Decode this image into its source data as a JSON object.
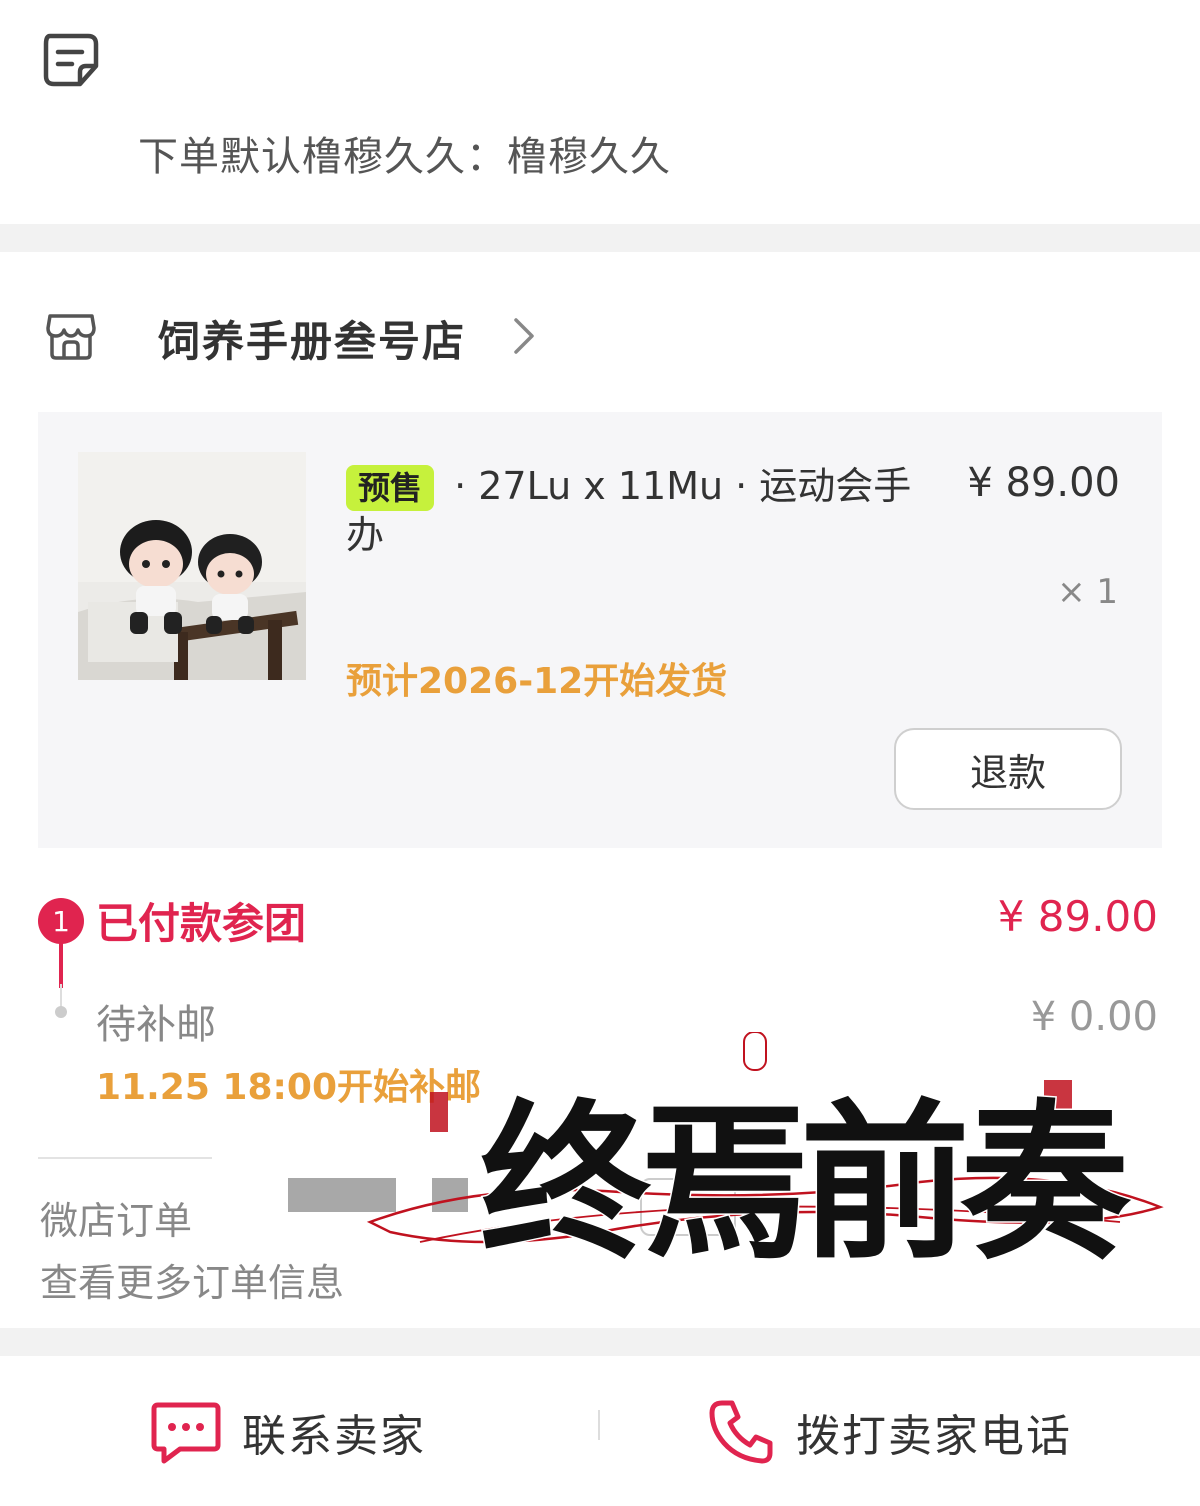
{
  "note": {
    "icon": "note-icon",
    "text": "下单默认橹穆久久：橹穆久久"
  },
  "shop": {
    "icon": "shop-icon",
    "name": "饲养手册叁号店",
    "chevron": "chevron-right-icon"
  },
  "product": {
    "tag": "预售",
    "title": " · 27Lu x 11Mu · 运动会手办",
    "price": "¥ 89.00",
    "quantity": "× 1",
    "ship_note": "预计2026-12开始发货",
    "refund_label": "退款"
  },
  "steps": [
    {
      "number": "1",
      "label": "已付款参团",
      "price": "¥ 89.00"
    },
    {
      "label": "待补邮",
      "price": "¥ 0.00",
      "note": "11.25 18:00开始补邮"
    }
  ],
  "order": {
    "order_label": "微店订单",
    "more_label": "查看更多订单信息"
  },
  "watermark": {
    "text": "终焉前奏"
  },
  "bottom_bar": {
    "contact_label": "联系卖家",
    "call_label": "拨打卖家电话"
  },
  "colors": {
    "accent_red": "#e0244f",
    "orange": "#e9a03b",
    "presale_green": "#c6f13c"
  }
}
